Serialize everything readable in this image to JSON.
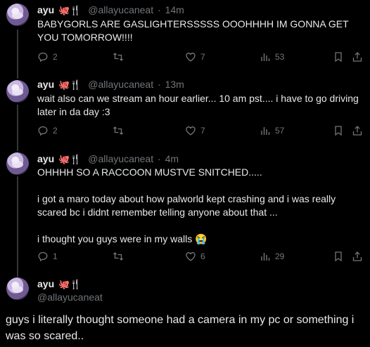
{
  "tweets": [
    {
      "name": "ayu",
      "emoji": "🐙🍴",
      "handle": "@allayucaneat",
      "dot": "·",
      "time": "14m",
      "lines": [
        "BABYGORLS ARE GASLIGHTERSSSSS OOOHHHH IM GONNA GET YOU TOMORROW!!!!"
      ],
      "replies": "2",
      "likes": "7",
      "views": "53"
    },
    {
      "name": "ayu",
      "emoji": "🐙🍴",
      "handle": "@allayucaneat",
      "dot": "·",
      "time": "13m",
      "lines": [
        "wait also can we stream an hour earlier... 10 am pst.... i have to go driving later in da day :3"
      ],
      "replies": "2",
      "likes": "7",
      "views": "57"
    },
    {
      "name": "ayu",
      "emoji": "🐙🍴",
      "handle": "@allayucaneat",
      "dot": "·",
      "time": "4m",
      "lines": [
        "OHHHH SO A RACCOON MUSTVE SNITCHED.....",
        "i got a maro today about how palworld kept crashing and i was really scared bc i didnt remember telling anyone about that ...",
        "i thought you guys were in my walls 😭"
      ],
      "replies": "1",
      "likes": "6",
      "views": "29"
    }
  ],
  "main_tweet": {
    "name": "ayu",
    "emoji": "🐙🍴",
    "handle": "@allayucaneat",
    "text": "guys i literally thought someone had a camera in my pc or something i was so scared.."
  },
  "icons": [
    "reply-icon",
    "retweet-icon",
    "like-icon",
    "views-icon",
    "bookmark-icon",
    "share-icon"
  ],
  "colors": {
    "background": "#000000",
    "text": "#e7e9ea",
    "muted": "#71767b",
    "thread_line": "#333639"
  }
}
